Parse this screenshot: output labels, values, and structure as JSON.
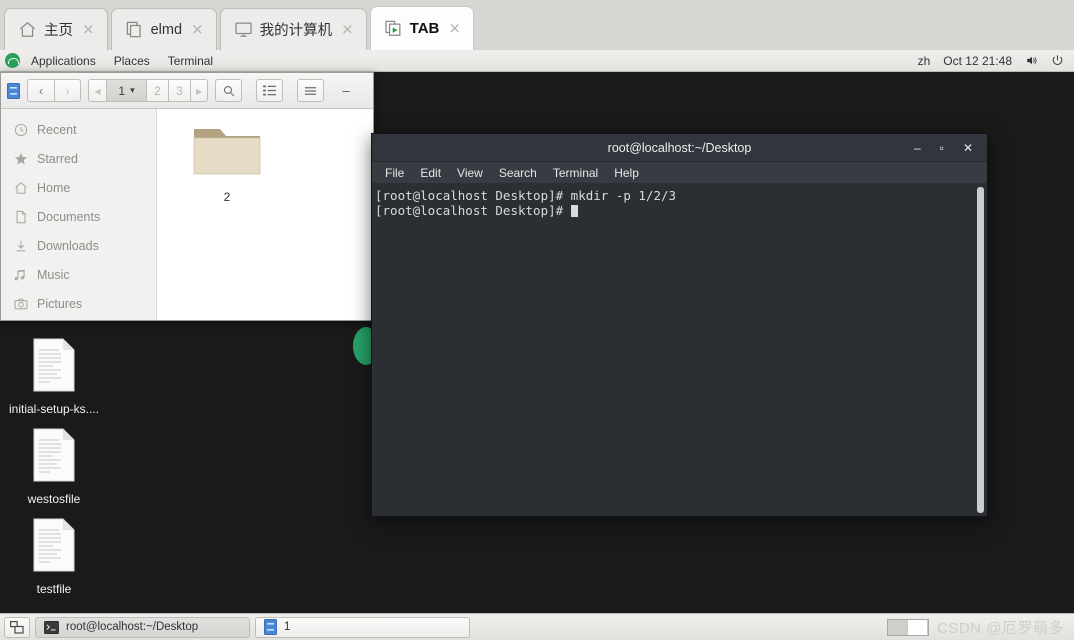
{
  "browser_tabs": [
    {
      "title": "主页",
      "icon": "home-icon",
      "active": false,
      "close": "×"
    },
    {
      "title": "elmd",
      "icon": "copy-icon",
      "active": false,
      "close": "×"
    },
    {
      "title": "我的计算机",
      "icon": "monitor-icon",
      "active": false,
      "close": "×"
    },
    {
      "title": "TAB",
      "icon": "play-window-icon",
      "active": true,
      "close": "×"
    }
  ],
  "gnome_panel": {
    "logo": "gnome-foot-icon",
    "menus": [
      "Applications",
      "Places",
      "Terminal"
    ],
    "keyboard_layout": "zh",
    "clock": "Oct 12  21:48",
    "volume_icon": "volume-icon",
    "power_icon": "power-icon"
  },
  "file_manager": {
    "toolbar": {
      "app_icon": "files-icon",
      "back": "‹",
      "forward": "›",
      "page_prev": "◂",
      "page_current": "1",
      "page_dropdown": "▾",
      "pages": [
        "2",
        "3"
      ],
      "page_next": "▸",
      "search": "search-icon",
      "list_view": "list-view-icon",
      "menu": "hamburger-menu-icon",
      "minimize": "–",
      "maximize": "▫",
      "close": "×"
    },
    "sidebar": [
      {
        "label": "Recent",
        "icon": "clock-icon"
      },
      {
        "label": "Starred",
        "icon": "star-icon"
      },
      {
        "label": "Home",
        "icon": "home-icon"
      },
      {
        "label": "Documents",
        "icon": "document-icon"
      },
      {
        "label": "Downloads",
        "icon": "download-icon"
      },
      {
        "label": "Music",
        "icon": "music-icon"
      },
      {
        "label": "Pictures",
        "icon": "camera-icon"
      }
    ],
    "files": [
      {
        "label": "2",
        "type": "folder"
      }
    ]
  },
  "desktop_icons": [
    {
      "label": "initial-setup-ks....",
      "type": "text-file"
    },
    {
      "label": "westosfile",
      "type": "text-file"
    },
    {
      "label": "testfile",
      "type": "text-file"
    }
  ],
  "terminal": {
    "title": "root@localhost:~/Desktop",
    "window_buttons": {
      "minimize": "–",
      "maximize": "▫",
      "close": "✕"
    },
    "menus": [
      "File",
      "Edit",
      "View",
      "Search",
      "Terminal",
      "Help"
    ],
    "lines": [
      "[root@localhost Desktop]# mkdir -p 1/2/3",
      "[root@localhost Desktop]# "
    ]
  },
  "taskbar": {
    "show_desktop_icon": "show-desktop-icon",
    "windows": [
      {
        "label": "root@localhost:~/Desktop",
        "icon": "terminal-icon",
        "active": true
      },
      {
        "label": "1",
        "icon": "files-icon",
        "active": false
      }
    ],
    "watermark": "CSDN @厄罗萌多"
  },
  "colors": {
    "desktop_bg": "#17181a",
    "accent_green": "#26a269",
    "terminal_bg": "#2b2e33",
    "panel_bg": "#eceae7"
  }
}
